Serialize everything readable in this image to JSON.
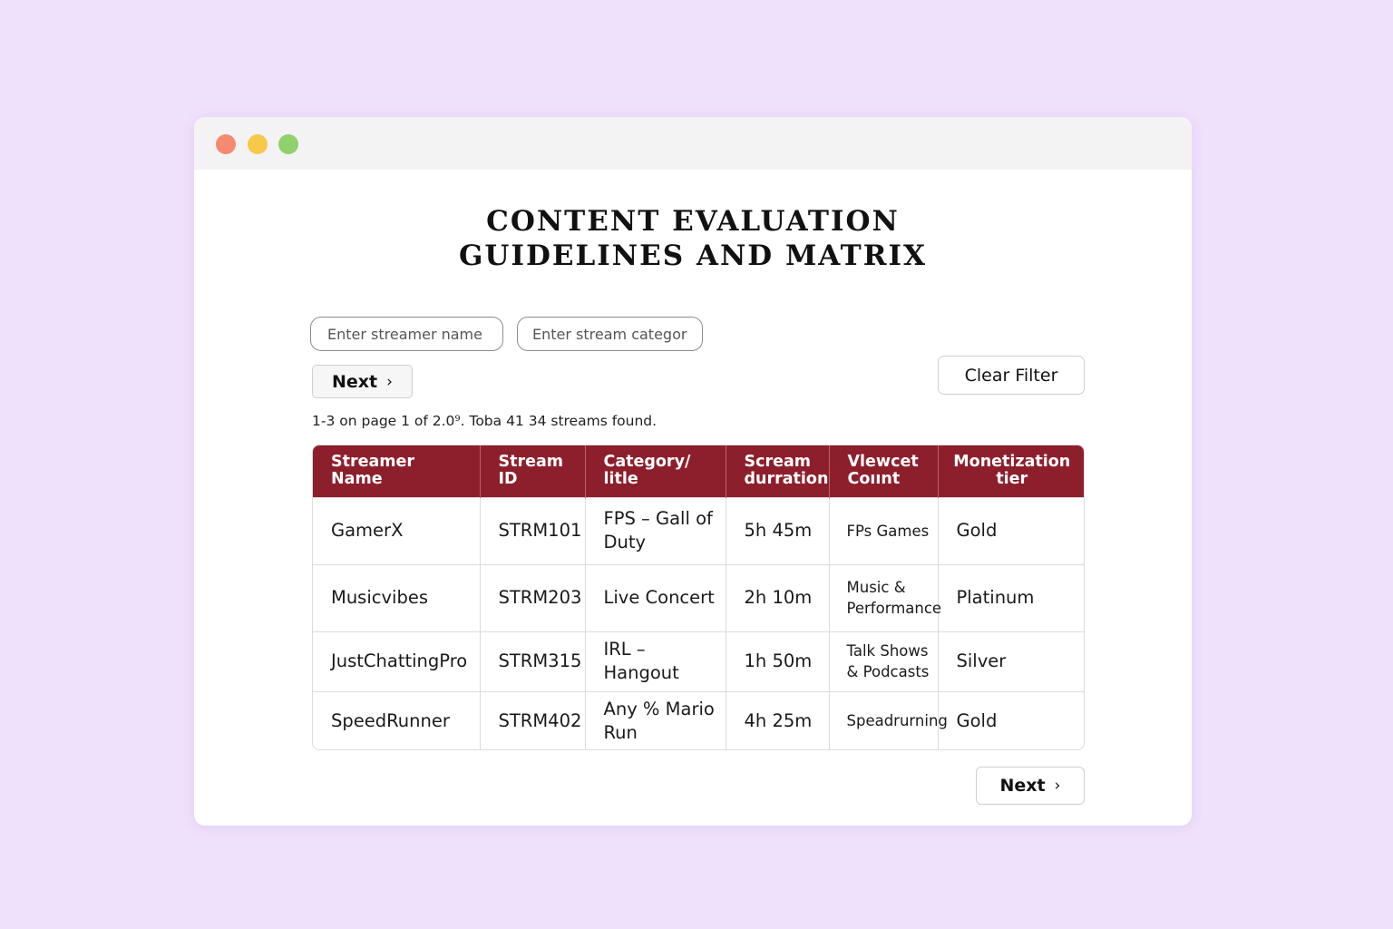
{
  "window": {
    "controls": [
      "close",
      "minimize",
      "maximize"
    ]
  },
  "title": {
    "line1": "CONTENT EVALUATION",
    "line2": "GUIDELINES AND MATRIX"
  },
  "filters": {
    "streamer_placeholder": "Enter streamer name",
    "category_placeholder": "Enter stream category",
    "next_label": "Next",
    "clear_label": "Clear Filter"
  },
  "results_text": "1-3 on page 1 of 2.0⁹. Toba 41 34 streams found.",
  "table": {
    "headers": [
      "Streamer Name",
      "Stream ID",
      "Category/ litle",
      "Scream durration",
      "Vlewcet Coıınt",
      "Monetization tier"
    ],
    "rows": [
      [
        "GamerX",
        "STRM101",
        "FPS – Gall of Duty",
        "5h 45m",
        "FPs Games",
        "Gold"
      ],
      [
        "Musicvibes",
        "STRM203",
        "Live Concert",
        "2h 10m",
        "Music & Performance",
        "Platinum"
      ],
      [
        "JustChattingPro",
        "STRM315",
        "IRL – Hangout",
        "1h 50m",
        "Talk Shows & Podcasts",
        "Silver"
      ],
      [
        "SpeedRunner",
        "STRM402",
        "Any % Mario Run",
        "4h 25m",
        "Speadrurning",
        "Gold"
      ]
    ]
  },
  "pagination": {
    "next_label": "Next"
  },
  "colors": {
    "background": "#efe0fc",
    "header_bg": "#8d1f2c",
    "close_dot": "#f58a70",
    "minimize_dot": "#f8c84a",
    "maximize_dot": "#8fd16a"
  }
}
